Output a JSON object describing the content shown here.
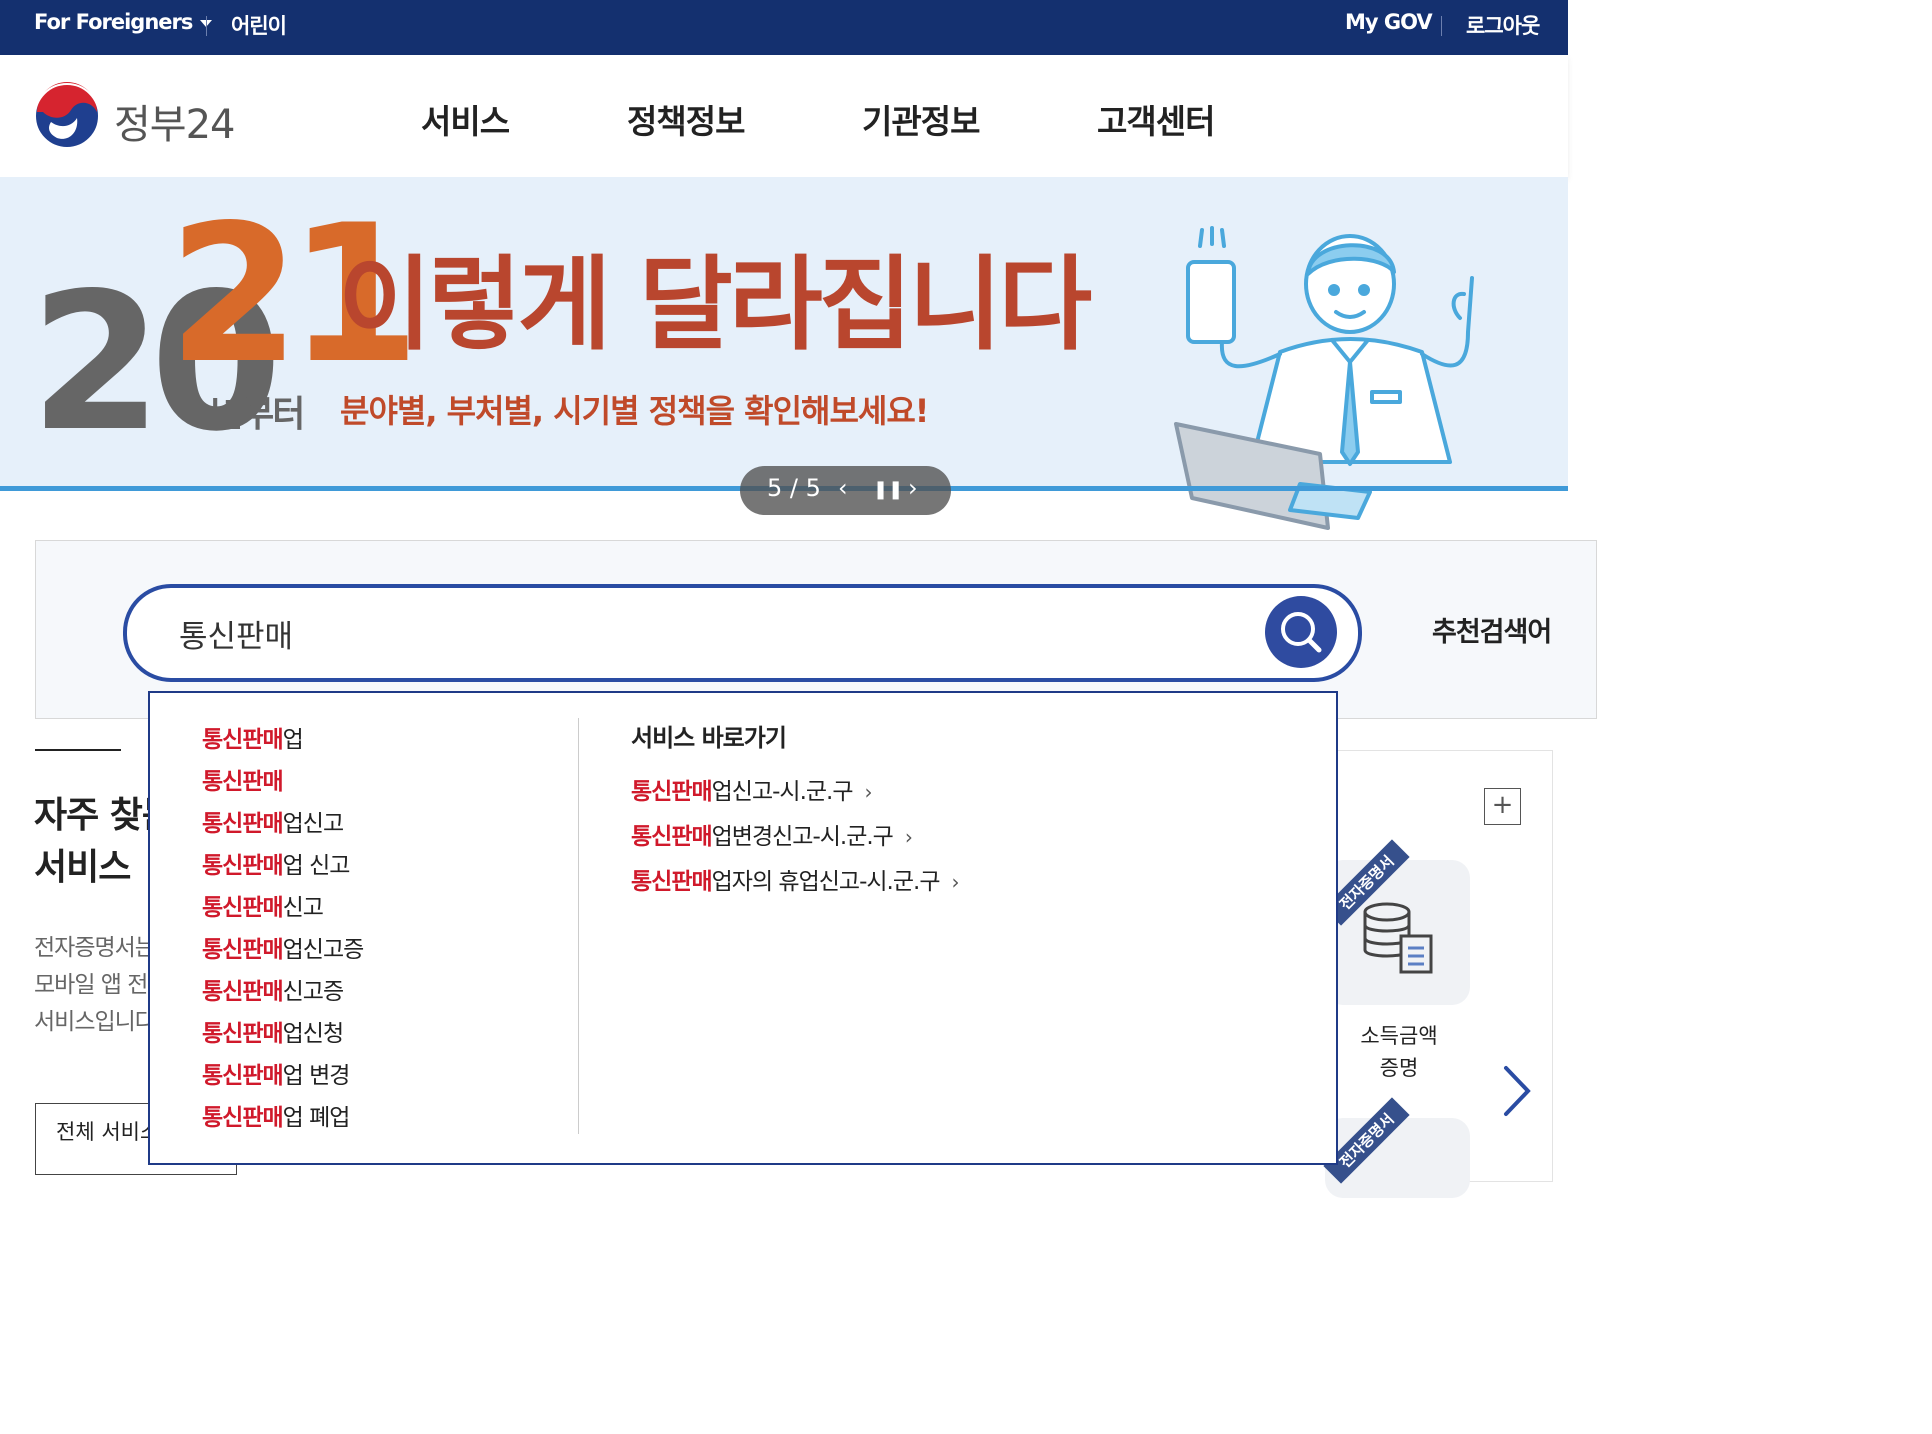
{
  "topbar": {
    "foreigners": "For Foreigners",
    "kids": "어린이",
    "mygov": "My GOV",
    "logout": "로그아웃"
  },
  "header": {
    "logo_text": "정부24",
    "nav": [
      "서비스",
      "정책정보",
      "기관정보",
      "고객센터"
    ]
  },
  "banner": {
    "year_prefix": "20",
    "year_suffix": "21",
    "since": "년부터",
    "headline": "이렇게 달라집니다",
    "subline": "분야별, 부처별, 시기별 정책을 확인해보세요!",
    "pager": "5 / 5"
  },
  "search": {
    "value": "통신판매",
    "recommended_label": "추천검색어"
  },
  "autocomplete": {
    "suggestions": [
      {
        "match": "통신판매",
        "rest": "업"
      },
      {
        "match": "통신판매",
        "rest": ""
      },
      {
        "match": "통신판매",
        "rest": "업신고"
      },
      {
        "match": "통신판매",
        "rest": "업 신고"
      },
      {
        "match": "통신판매",
        "rest": "신고"
      },
      {
        "match": "통신판매",
        "rest": "업신고증"
      },
      {
        "match": "통신판매",
        "rest": "신고증"
      },
      {
        "match": "통신판매",
        "rest": "업신청"
      },
      {
        "match": "통신판매",
        "rest": "업 변경"
      },
      {
        "match": "통신판매",
        "rest": "업 폐업"
      }
    ],
    "service_title": "서비스 바로가기",
    "services": [
      {
        "match": "통신판매",
        "rest": "업신고-시.군.구"
      },
      {
        "match": "통신판매",
        "rest": "업변경신고-시.군.구"
      },
      {
        "match": "통신판매",
        "rest": "업자의 휴업신고-시.군.구"
      }
    ]
  },
  "frequent": {
    "title_line1": "자주 찾는",
    "title_line2": "서비스",
    "desc_line1": "전자증명서는",
    "desc_line2": "모바일 앱 전",
    "desc_line3": "서비스입니다",
    "all_services": "전체 서비스",
    "plus": "+",
    "ribbon": "전자증명서",
    "tile_label_line1": "소득금액",
    "tile_label_line2": "증명"
  },
  "colors": {
    "topbar": "#14306f",
    "accent_blue": "#2a4ca3",
    "highlight_red": "#d0192b",
    "banner_orange": "#d86a2a",
    "banner_red": "#b9462e"
  }
}
